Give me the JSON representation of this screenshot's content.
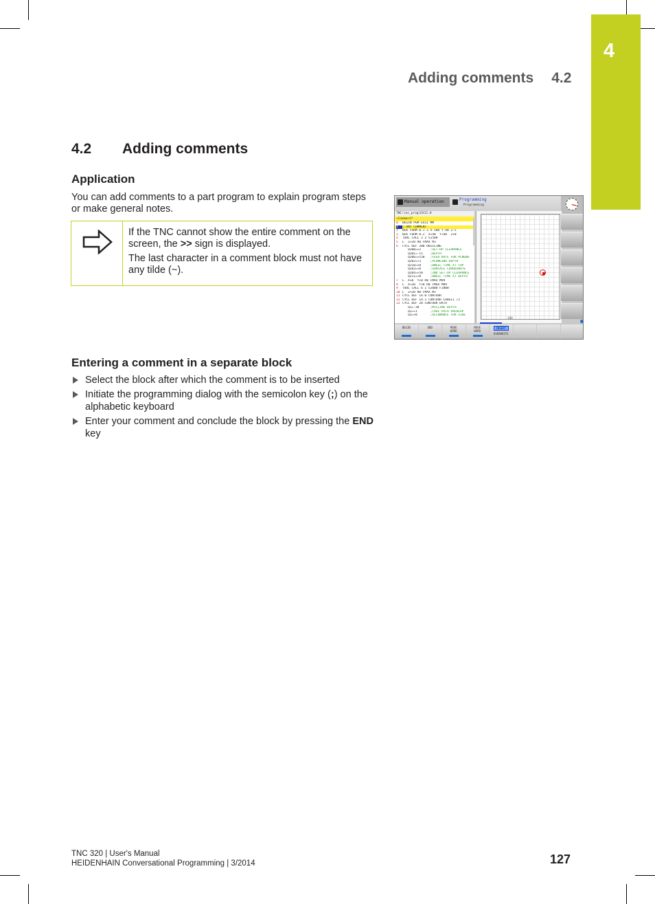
{
  "chapter_tab": {
    "number": "4",
    "color": "#c3cf21"
  },
  "running_head": {
    "title": "Adding comments",
    "section": "4.2"
  },
  "section_heading": {
    "number": "4.2",
    "title": "Adding comments"
  },
  "application": {
    "heading": "Application",
    "body": "You can add comments to a part program to explain program steps or make general notes."
  },
  "note": {
    "icon": "arrow-right-icon",
    "p1_before": "If the TNC cannot show the entire comment on the screen, the ",
    "p1_bold": ">>",
    "p1_after": " sign is displayed.",
    "p2": "The last character in a comment block must not have any tilde (~)."
  },
  "entering": {
    "heading": "Entering a comment in a separate block",
    "steps": [
      {
        "before": "Select the block after which the comment is to be inserted",
        "bold": "",
        "after": ""
      },
      {
        "before": "Initiate the programming dialog with the semicolon key (",
        "bold": ";",
        "after": ") on the alphabetic keyboard"
      },
      {
        "before": "Enter your comment and conclude the block by pressing the ",
        "bold": "END",
        "after": " key"
      }
    ]
  },
  "screenshot": {
    "mode_manual": "Manual operation",
    "mode_programming": "Programming",
    "mode_programming_sub": "Programming",
    "path": "TNC:\\nc_prog\\EX11.H",
    "input_prompt": "Comment?",
    "lines": [
      {
        "n": "0",
        "code": "BEGIN PGM EX11 MM",
        "comment": ""
      },
      {
        "n": "1",
        "code": ";-ANY COMMENT",
        "comment": "",
        "selected": true
      },
      {
        "n": "2",
        "code": "BLK FORM 0.1 Z X-100 Y-40 Z-5",
        "comment": ""
      },
      {
        "n": "3",
        "code": "BLK FORM 0.2  X+40  Y+40  Z+0",
        "comment": ""
      },
      {
        "n": "4",
        "code": "TOOL CALL 3 Z S1500",
        "comment": ""
      },
      {
        "n": "5",
        "code": "L  Z+20 R0 FMAX M3",
        "comment": ""
      },
      {
        "n": "6",
        "code": "CYCL DEF 200 DRILLING",
        "comment": ""
      },
      {
        "n": "",
        "code": "   Q200=+2     ",
        "comment": ";SET-UP CLEARANCE"
      },
      {
        "n": "",
        "code": "   Q201=-15    ",
        "comment": ";DEPTH"
      },
      {
        "n": "",
        "code": "   Q206=+150   ",
        "comment": ";FEED RATE FOR PLNGNG"
      },
      {
        "n": "",
        "code": "   Q202=+3     ",
        "comment": ";PLUNGING DEPTH"
      },
      {
        "n": "",
        "code": "   Q210=+0     ",
        "comment": ";DWELL TIME AT TOP"
      },
      {
        "n": "",
        "code": "   Q203=+0     ",
        "comment": ";SURFACE COORDINATE"
      },
      {
        "n": "",
        "code": "   Q204=+50    ",
        "comment": ";2ND SET-UP CLEARANCE"
      },
      {
        "n": "",
        "code": "   Q211=+0     ",
        "comment": ";DWELL TIME AT DEPTH"
      },
      {
        "n": "7",
        "code": "L  X+0  Y+0 R0 FMAX M99",
        "comment": ""
      },
      {
        "n": "8",
        "code": "L  X+30  Y+0 R0 FMAX M99",
        "comment": ""
      },
      {
        "n": "9",
        "code": "TOOL CALL 6 Z S2000 F2000",
        "comment": ""
      },
      {
        "n": "10",
        "code": "L  Z+20 R0 FMAX M3",
        "comment": ""
      },
      {
        "n": "11",
        "code": "CYCL DEF 14.0 CONTOUR",
        "comment": ""
      },
      {
        "n": "12",
        "code": "CYCL DEF 14.1 CONTOUR LABEL1 /2",
        "comment": ""
      },
      {
        "n": "13",
        "code": "CYCL DEF 20 CONTOUR DATA",
        "comment": ""
      },
      {
        "n": "",
        "code": "   Q1=-30      ",
        "comment": ";MILLING DEPTH"
      },
      {
        "n": "",
        "code": "   Q2=+1       ",
        "comment": ";TOOL PATH OVERLAP"
      },
      {
        "n": "",
        "code": "   Q3=+0       ",
        "comment": ";ALLOWANCE FOR SIDE"
      }
    ],
    "axis_x_label": "-100",
    "softkeys": [
      {
        "l1": "BEGIN",
        "l2": "",
        "icon": "arrow-left-bar-icon"
      },
      {
        "l1": "END",
        "l2": "",
        "icon": "arrow-right-bar-icon"
      },
      {
        "l1": "MOVE",
        "l2": "WORD",
        "icon": "arrow-left-icon"
      },
      {
        "l1": "MOVE",
        "l2": "WORD",
        "icon": "arrow-right-icon"
      },
      {
        "l1": "INSERT",
        "l2": "OVERWRITE",
        "icon": ""
      },
      {
        "l1": "",
        "l2": "",
        "icon": ""
      },
      {
        "l1": "",
        "l2": "",
        "icon": ""
      },
      {
        "l1": "",
        "l2": "",
        "icon": ""
      }
    ]
  },
  "footer": {
    "line1": "TNC 320 | User's Manual",
    "line2": "HEIDENHAIN Conversational Programming | 3/2014",
    "page": "127"
  }
}
